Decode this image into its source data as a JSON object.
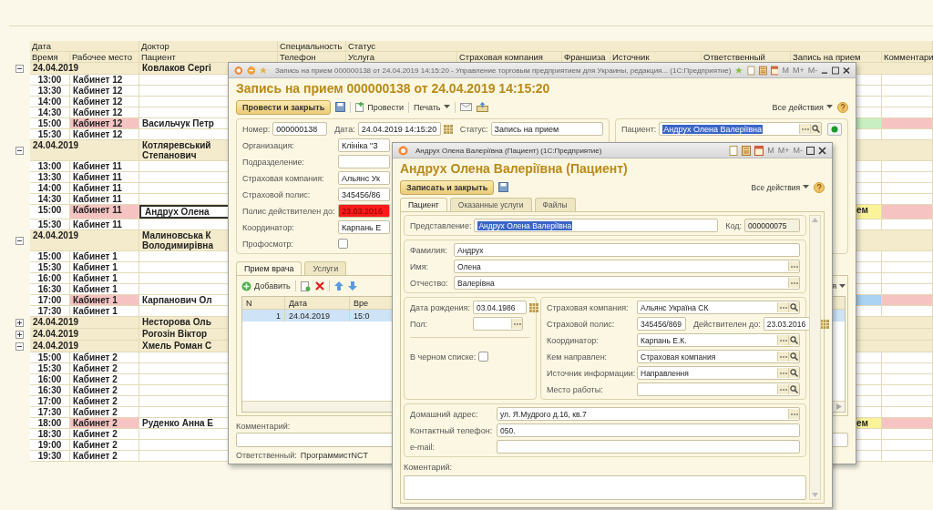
{
  "table": {
    "header_top": {
      "date": "Дата",
      "doctor": "Доктор",
      "specialty": "Специальность",
      "status": "Статус"
    },
    "header_bottom": [
      "Время",
      "Рабочее место",
      "Пациент",
      "Телефон",
      "Услуга",
      "Страховая компания",
      "Франшиза",
      "Источник",
      "Ответственный",
      "Запись на прием",
      "Комментари"
    ],
    "rows": [
      {
        "kind": "group",
        "expanded": true,
        "selected": false,
        "date": "24.04.2019",
        "doctor": [
          "Ковлаков Сергі"
        ]
      },
      {
        "kind": "slot",
        "selected": false,
        "booked": false,
        "time": "13:00",
        "place": "Кабинет 12"
      },
      {
        "kind": "slot",
        "selected": false,
        "booked": false,
        "time": "13:30",
        "place": "Кабинет 12"
      },
      {
        "kind": "slot",
        "selected": false,
        "booked": false,
        "time": "14:00",
        "place": "Кабинет 12"
      },
      {
        "kind": "slot",
        "selected": false,
        "booked": false,
        "time": "14:30",
        "place": "Кабинет 12"
      },
      {
        "kind": "slot",
        "selected": false,
        "booked": true,
        "time": "15:00",
        "place": "Кабинет 12",
        "patient": "Васильчук Петр",
        "record": {
          "color": "#c8efc2"
        },
        "comment": {
          "color": "#f6c3c3"
        }
      },
      {
        "kind": "slot",
        "selected": false,
        "booked": false,
        "time": "15:30",
        "place": "Кабинет 12"
      },
      {
        "kind": "group",
        "expanded": true,
        "selected": false,
        "date": "24.04.2019",
        "doctor": [
          "Котляревський",
          "Степанович"
        ]
      },
      {
        "kind": "slot",
        "selected": false,
        "booked": false,
        "time": "13:00",
        "place": "Кабинет 11"
      },
      {
        "kind": "slot",
        "selected": false,
        "booked": false,
        "time": "13:30",
        "place": "Кабинет 11"
      },
      {
        "kind": "slot",
        "selected": false,
        "booked": false,
        "time": "14:00",
        "place": "Кабинет 11"
      },
      {
        "kind": "slot",
        "selected": false,
        "booked": false,
        "time": "14:30",
        "place": "Кабинет 11"
      },
      {
        "kind": "slot",
        "selected": true,
        "booked": true,
        "time": "15:00",
        "place": "Кабинет 11",
        "patient": "Андрух Олена",
        "record": {
          "color": "#fbf39a",
          "text": "ем"
        },
        "comment": {
          "color": "#f6c3c3"
        }
      },
      {
        "kind": "slot",
        "selected": false,
        "booked": false,
        "time": "15:30",
        "place": "Кабинет 11"
      },
      {
        "kind": "group",
        "expanded": true,
        "selected": false,
        "date": "24.04.2019",
        "doctor": [
          "Малиновська К",
          "Володимирівна"
        ]
      },
      {
        "kind": "slot",
        "selected": false,
        "booked": false,
        "time": "15:00",
        "place": "Кабинет 1"
      },
      {
        "kind": "slot",
        "selected": false,
        "booked": false,
        "time": "15:30",
        "place": "Кабинет 1"
      },
      {
        "kind": "slot",
        "selected": false,
        "booked": false,
        "time": "16:00",
        "place": "Кабинет 1"
      },
      {
        "kind": "slot",
        "selected": false,
        "booked": false,
        "time": "16:30",
        "place": "Кабинет 1"
      },
      {
        "kind": "slot",
        "selected": false,
        "booked": true,
        "time": "17:00",
        "place": "Кабинет 1",
        "patient": "Карпанович Ол",
        "record": {
          "color": "#a9d2f3"
        },
        "comment": {
          "color": "#f6c3c3"
        }
      },
      {
        "kind": "slot",
        "selected": false,
        "booked": false,
        "time": "17:30",
        "place": "Кабинет 1"
      },
      {
        "kind": "group",
        "expanded": false,
        "selected": false,
        "date": "24.04.2019",
        "doctor": [
          "Несторова Оль"
        ]
      },
      {
        "kind": "group",
        "expanded": false,
        "selected": false,
        "date": "24.04.2019",
        "doctor": [
          "Рогозін Віктор"
        ]
      },
      {
        "kind": "group",
        "expanded": true,
        "selected": false,
        "date": "24.04.2019",
        "doctor": [
          "Хмель Роман С"
        ]
      },
      {
        "kind": "slot",
        "selected": false,
        "booked": false,
        "time": "15:00",
        "place": "Кабинет 2"
      },
      {
        "kind": "slot",
        "selected": false,
        "booked": false,
        "time": "15:30",
        "place": "Кабинет 2"
      },
      {
        "kind": "slot",
        "selected": false,
        "booked": false,
        "time": "16:00",
        "place": "Кабинет 2"
      },
      {
        "kind": "slot",
        "selected": false,
        "booked": false,
        "time": "16:30",
        "place": "Кабинет 2"
      },
      {
        "kind": "slot",
        "selected": false,
        "booked": false,
        "time": "17:00",
        "place": "Кабинет 2"
      },
      {
        "kind": "slot",
        "selected": false,
        "booked": false,
        "time": "17:30",
        "place": "Кабинет 2"
      },
      {
        "kind": "slot",
        "selected": false,
        "booked": true,
        "time": "18:00",
        "place": "Кабинет 2",
        "patient": "Руденко Анна Е",
        "record": {
          "color": "#fbf39a",
          "text": "ем"
        },
        "comment": {
          "color": "#f6c3c3"
        }
      },
      {
        "kind": "slot",
        "selected": false,
        "booked": false,
        "time": "18:30",
        "place": "Кабинет 2"
      },
      {
        "kind": "slot",
        "selected": false,
        "booked": false,
        "time": "19:00",
        "place": "Кабинет 2"
      },
      {
        "kind": "slot",
        "selected": false,
        "booked": false,
        "time": "19:30",
        "place": "Кабинет 2"
      }
    ]
  },
  "appointment_window": {
    "title": "Запись на прием 000000138 от 24.04.2019 14:15:20 - Управление торговым предприятием для Украины, редакция... (1С:Предприятие)",
    "memory_buttons": [
      "M",
      "M+",
      "M-"
    ],
    "heading": "Запись на прием 000000138 от 24.04.2019 14:15:20",
    "post_close": "Провести и закрыть",
    "post": "Провести",
    "print": "Печать",
    "all_actions": "Все действия",
    "number": {
      "label": "Номер:",
      "value": "000000138"
    },
    "date": {
      "label": "Дата:",
      "value": "24.04.2019 14:15:20"
    },
    "status": {
      "label": "Статус:",
      "value": "Запись на прием"
    },
    "fields": [
      {
        "kind": "text",
        "label": "Организация:",
        "value": "Клініка \"З"
      },
      {
        "kind": "text",
        "label": "Подразделение:"
      },
      {
        "kind": "text",
        "label": "Страховая компания:",
        "value": "Альянс Ук"
      },
      {
        "kind": "text",
        "label": "Страховой полис:",
        "value": "345456/86"
      },
      {
        "kind": "date",
        "label": "Полис действителен до:",
        "value": "23.03.2016",
        "expired": true
      },
      {
        "kind": "text",
        "label": "Координатор:",
        "value": "Карпань Е"
      },
      {
        "kind": "checkbox",
        "label": "Профосмотр:",
        "checked": false
      }
    ],
    "patient": {
      "label": "Пациент:",
      "value": "Андрух Олена Валеріївна"
    },
    "tabs": [
      {
        "label": "Прием врача",
        "selected": true
      },
      {
        "label": "Услуги",
        "selected": false
      }
    ],
    "add": "Добавить",
    "side_menu": "я",
    "grid": {
      "columns": [
        "N",
        "Дата",
        "Вре"
      ],
      "rows": [
        {
          "n": "1",
          "date": "24.04.2019",
          "time": "15:0",
          "selected": true
        }
      ]
    },
    "comment_label": "Комментарий:",
    "responsible": {
      "label": "Ответственный:",
      "value": "ПрограммистNCT"
    }
  },
  "patient_window": {
    "title": "Андрух Олена Валеріївна (Пациент)  (1С:Предприятие)",
    "memory_buttons": [
      "M",
      "M+",
      "M-"
    ],
    "heading": "Андрух Олена Валеріївна (Пациент)",
    "save_close": "Записать и закрыть",
    "all_actions": "Все действия",
    "tabs": [
      {
        "label": "Пациент",
        "selected": true
      },
      {
        "label": "Оказанные услуги",
        "selected": false
      },
      {
        "label": "Файлы",
        "selected": false
      }
    ],
    "presentation": {
      "label": "Представление:",
      "value": "Андрух Олена Валеріївна"
    },
    "code": {
      "label": "Код:",
      "value": "000000075"
    },
    "name_fields": [
      {
        "kind": "text",
        "label": "Фамилия:",
        "value": "Андрух"
      },
      {
        "kind": "choice",
        "label": "Имя:",
        "value": "Олена"
      },
      {
        "kind": "choice",
        "label": "Отчество:",
        "value": "Валерівна"
      }
    ],
    "birth": {
      "label": "Дата рождения:",
      "value": "03.04.1986"
    },
    "sex": {
      "label": "Пол:"
    },
    "blacklist": {
      "label": "В черном списке:",
      "checked": false
    },
    "insurance_fields": [
      {
        "kind": "lookup",
        "label": "Страховая компания:",
        "value": "Альянс Україна СК"
      },
      {
        "kind": "policy",
        "label": "Страховой полис:",
        "value": "345456/869",
        "valid_label": "Действителен до:",
        "valid_value": "23.03.2016"
      },
      {
        "kind": "lookup",
        "label": "Координатор:",
        "value": "Карпань Е.К."
      },
      {
        "kind": "lookup",
        "label": "Кем направлен:",
        "value": "Страховая компания"
      },
      {
        "kind": "lookup",
        "label": "Источник информации:",
        "value": "Направлення"
      },
      {
        "kind": "lookup",
        "label": "Место работы:"
      }
    ],
    "contact_fields": [
      {
        "kind": "choice",
        "label": "Домашний адрес:",
        "value": "ул. Я.Мудрого д.16, кв.7"
      },
      {
        "kind": "text",
        "label": "Контактный телефон:",
        "value": "050."
      },
      {
        "kind": "text",
        "label": "e-mail:"
      }
    ],
    "comment_label": "Коментарий:"
  }
}
